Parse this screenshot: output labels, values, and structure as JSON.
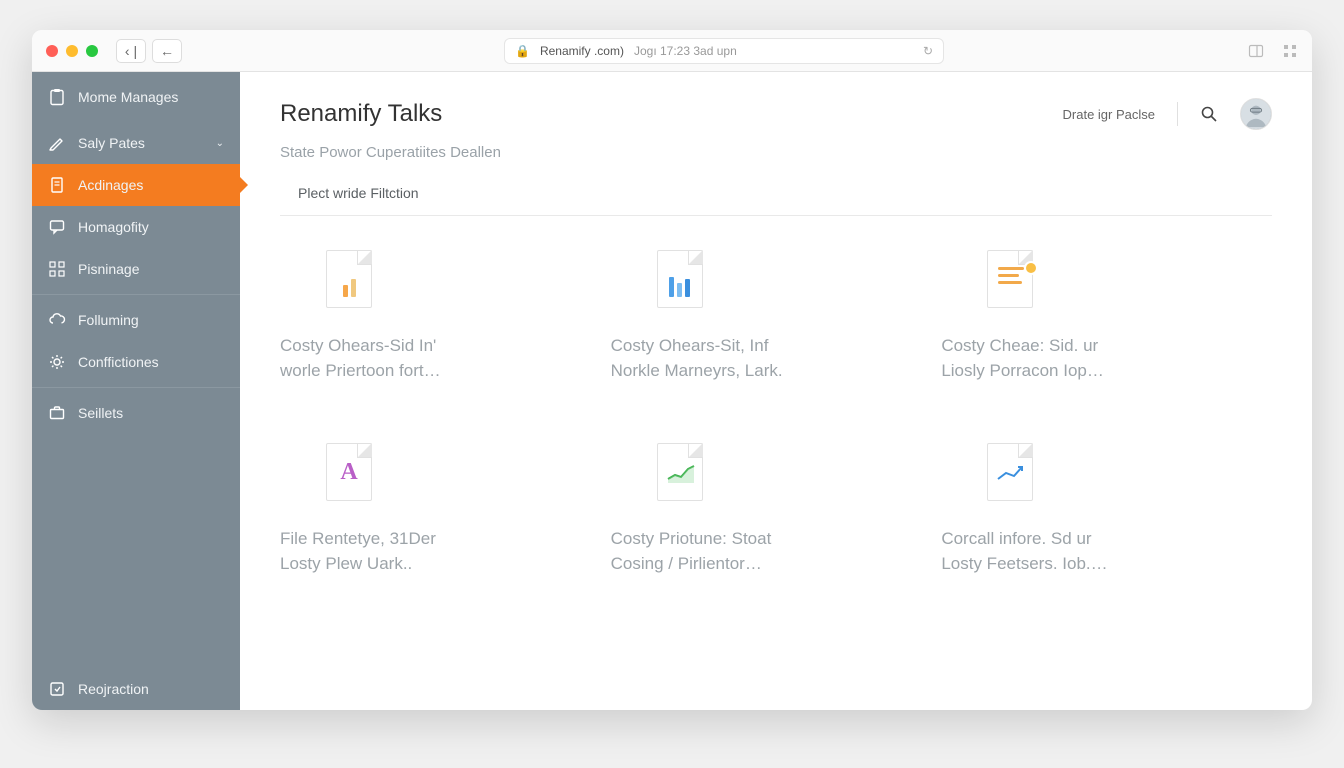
{
  "titlebar": {
    "domain": "Renamify .com)",
    "timestamp": "Jogı 17:23 3ad upn"
  },
  "sidebar": {
    "header_label": "Mome Manages",
    "items": [
      {
        "label": "Saly Pates",
        "expandable": true
      },
      {
        "label": "Acdinages",
        "active": true
      },
      {
        "label": "Homagofity"
      },
      {
        "label": "Pisninage"
      },
      {
        "label": "Folluming"
      },
      {
        "label": "Conffictiones"
      },
      {
        "label": "Seillets"
      }
    ],
    "footer_label": "Reojraction"
  },
  "main": {
    "page_title": "Renamify Talks",
    "header_link": "Drate igr Paclse",
    "subtitle": "State Powor Cuperatiites Deallen",
    "filter_label": "Plect wride Filtction",
    "cards": [
      {
        "title_l1": "Costy Ohears-Sid In'",
        "title_l2": "worle Priertoon fort…",
        "icon": "bars-orange"
      },
      {
        "title_l1": "Costy Ohears-Sit, Inf",
        "title_l2": "Norkle Marneyrs, Lark.",
        "icon": "bars-blue"
      },
      {
        "title_l1": "Costy Cheae: Sid. ur",
        "title_l2": "Liosly Porracon Iop…",
        "icon": "lines-badge"
      },
      {
        "title_l1": "File Rentetye, 31Der",
        "title_l2": "Losty Plew Uark..",
        "icon": "letter-a"
      },
      {
        "title_l1": "Costy Priotune: Stoat",
        "title_l2": "Cosing / Pirlientor…",
        "icon": "trend-green"
      },
      {
        "title_l1": "Corcall infore. Sd ur",
        "title_l2": "Losty Feetsers. Iob.…",
        "icon": "trend-blue"
      }
    ]
  }
}
